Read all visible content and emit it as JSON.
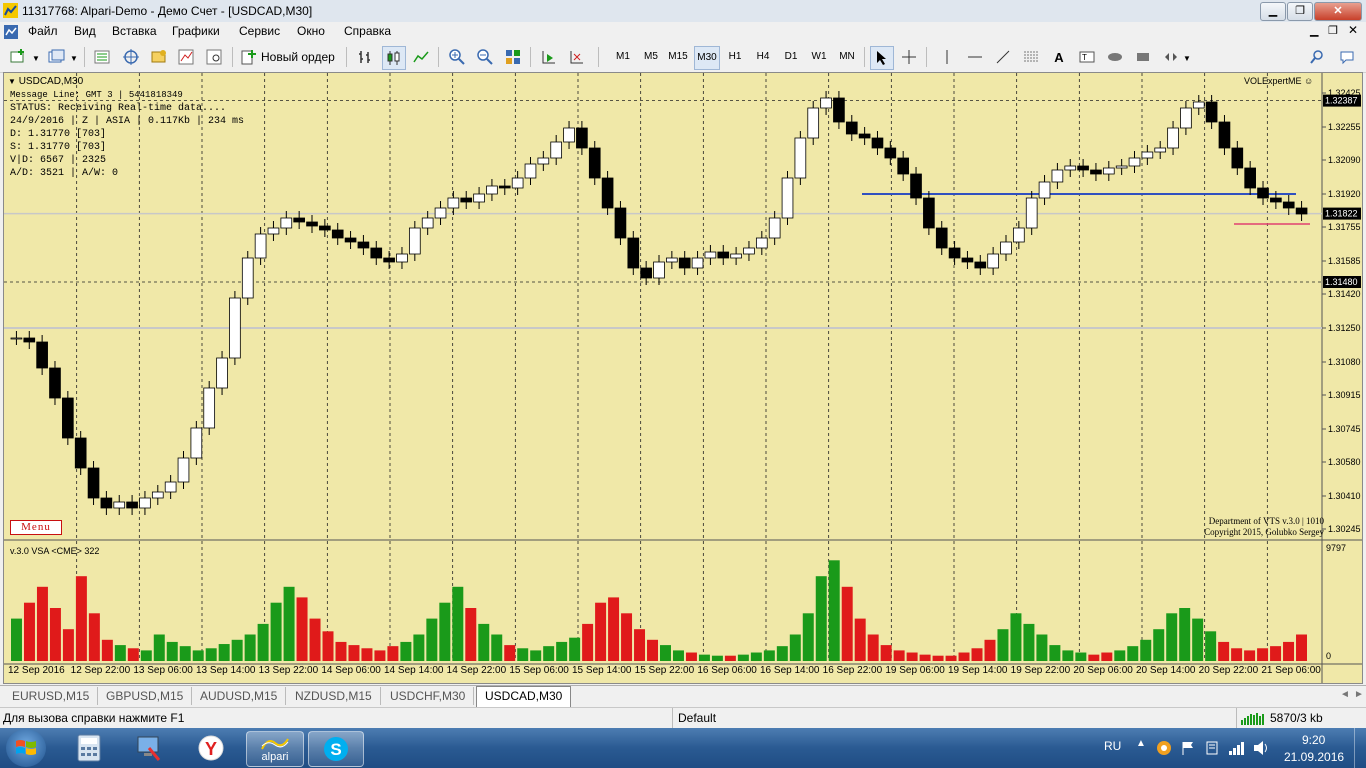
{
  "window": {
    "title": "11317768: Alpari-Demo - Демо Счет - [USDCAD,M30]",
    "controls": [
      "minimize",
      "restore",
      "close"
    ]
  },
  "menu": [
    "Файл",
    "Вид",
    "Вставка",
    "Графики",
    "Сервис",
    "Окно",
    "Справка"
  ],
  "toolbar": {
    "new_order_label": "Новый ордер",
    "timeframes": [
      "M1",
      "M5",
      "M15",
      "M30",
      "H1",
      "H4",
      "D1",
      "W1",
      "MN"
    ],
    "active_timeframe": "M30",
    "text_tool_label": "A"
  },
  "chart": {
    "header": "USDCAD,M30",
    "info_lines": [
      "Message Line: GMT 3 | 5441818349",
      "STATUS:  Receiving Real-time data....",
      "24/9/2016 | Z | ASIA | 0.117Kb | 234 ms",
      "D: 1.31770  [703]",
      "S: 1.31770  [703]",
      "V|D: 6567 | 2325",
      "A/D: 3521 | A/W: 0"
    ],
    "expert_name": "VOLExpertME",
    "menu_button": "Menu",
    "copyright_lines": [
      "Department of VTS  v.3.0 | 1010",
      "Copyright 2015, Golubko Sergey"
    ],
    "price_labels": [
      "1.32425",
      "1.32255",
      "1.32090",
      "1.31920",
      "1.31755",
      "1.31585",
      "1.31420",
      "1.31250",
      "1.31080",
      "1.30915",
      "1.30745",
      "1.30580",
      "1.30410",
      "1.30245"
    ],
    "price_markers": [
      {
        "value": "1.32387",
        "kind": "level"
      },
      {
        "value": "1.31822",
        "kind": "bid"
      },
      {
        "value": "1.31480",
        "kind": "level"
      }
    ],
    "subwindow_title": "v.3.0 VSA <CME> 322",
    "subwindow_max": "9797",
    "subwindow_min": "0",
    "time_labels": [
      "12 Sep 2016",
      "12 Sep 22:00",
      "13 Sep 06:00",
      "13 Sep 14:00",
      "13 Sep 22:00",
      "14 Sep 06:00",
      "14 Sep 14:00",
      "14 Sep 22:00",
      "15 Sep 06:00",
      "15 Sep 14:00",
      "15 Sep 22:00",
      "16 Sep 06:00",
      "16 Sep 14:00",
      "16 Sep 22:00",
      "19 Sep 06:00",
      "19 Sep 14:00",
      "19 Sep 22:00",
      "20 Sep 06:00",
      "20 Sep 14:00",
      "20 Sep 22:00",
      "21 Sep 06:00"
    ]
  },
  "chart_data": {
    "type": "candlestick",
    "symbol": "USDCAD",
    "timeframe": "M30",
    "ylim": [
      1.30245,
      1.32425
    ],
    "horizontal_lines": [
      1.32387,
      1.3148,
      1.3192,
      1.3177,
      1.3125
    ],
    "close_trace": [
      1.312,
      1.3118,
      1.3105,
      1.309,
      1.307,
      1.3055,
      1.304,
      1.3035,
      1.3038,
      1.3035,
      1.304,
      1.3043,
      1.3048,
      1.306,
      1.3075,
      1.3095,
      1.311,
      1.314,
      1.316,
      1.3172,
      1.3175,
      1.318,
      1.3178,
      1.3176,
      1.3174,
      1.317,
      1.3168,
      1.3165,
      1.316,
      1.3158,
      1.3162,
      1.3175,
      1.318,
      1.3185,
      1.319,
      1.3188,
      1.3192,
      1.3196,
      1.3195,
      1.32,
      1.3207,
      1.321,
      1.3218,
      1.3225,
      1.3215,
      1.32,
      1.3185,
      1.317,
      1.3155,
      1.315,
      1.3158,
      1.316,
      1.3155,
      1.316,
      1.3163,
      1.316,
      1.3162,
      1.3165,
      1.317,
      1.318,
      1.32,
      1.322,
      1.3235,
      1.324,
      1.3228,
      1.3222,
      1.322,
      1.3215,
      1.321,
      1.3202,
      1.319,
      1.3175,
      1.3165,
      1.316,
      1.3158,
      1.3155,
      1.3162,
      1.3168,
      1.3175,
      1.319,
      1.3198,
      1.3204,
      1.3206,
      1.3204,
      1.3202,
      1.3205,
      1.3206,
      1.321,
      1.3213,
      1.3215,
      1.3225,
      1.3235,
      1.3238,
      1.3228,
      1.3215,
      1.3205,
      1.3195,
      1.319,
      1.3188,
      1.3185,
      1.3182
    ],
    "volume_trace": [
      40,
      55,
      70,
      50,
      30,
      80,
      45,
      20,
      15,
      12,
      10,
      25,
      18,
      14,
      10,
      12,
      16,
      20,
      25,
      35,
      55,
      70,
      60,
      40,
      28,
      18,
      15,
      12,
      10,
      14,
      18,
      25,
      40,
      55,
      70,
      50,
      35,
      25,
      15,
      12,
      10,
      14,
      18,
      22,
      35,
      55,
      60,
      45,
      30,
      20,
      15,
      10,
      8,
      6,
      5,
      5,
      6,
      8,
      10,
      14,
      25,
      45,
      80,
      95,
      70,
      40,
      25,
      15,
      10,
      8,
      6,
      5,
      5,
      8,
      12,
      20,
      30,
      45,
      35,
      25,
      15,
      10,
      8,
      6,
      8,
      10,
      14,
      20,
      30,
      45,
      50,
      40,
      28,
      18,
      12,
      10,
      12,
      14,
      18,
      25
    ]
  },
  "tabs": [
    "EURUSD,M15",
    "GBPUSD,M15",
    "AUDUSD,M15",
    "NZDUSD,M15",
    "USDCHF,M30",
    "USDCAD,M30"
  ],
  "active_tab": "USDCAD,M30",
  "status": {
    "help_text": "Для вызова справки нажмите F1",
    "profile": "Default",
    "connection": "5870/3 kb"
  },
  "taskbar": {
    "pinned_label": "alpari",
    "lang": "RU",
    "time": "9:20",
    "date": "21.09.2016"
  },
  "colors": {
    "chart_bg": "#f0e8a8",
    "bull_volume": "#1a9a1a",
    "bear_volume": "#e01a1a",
    "level_line": "#3050c0",
    "bid_line": "#c8c8c8"
  }
}
